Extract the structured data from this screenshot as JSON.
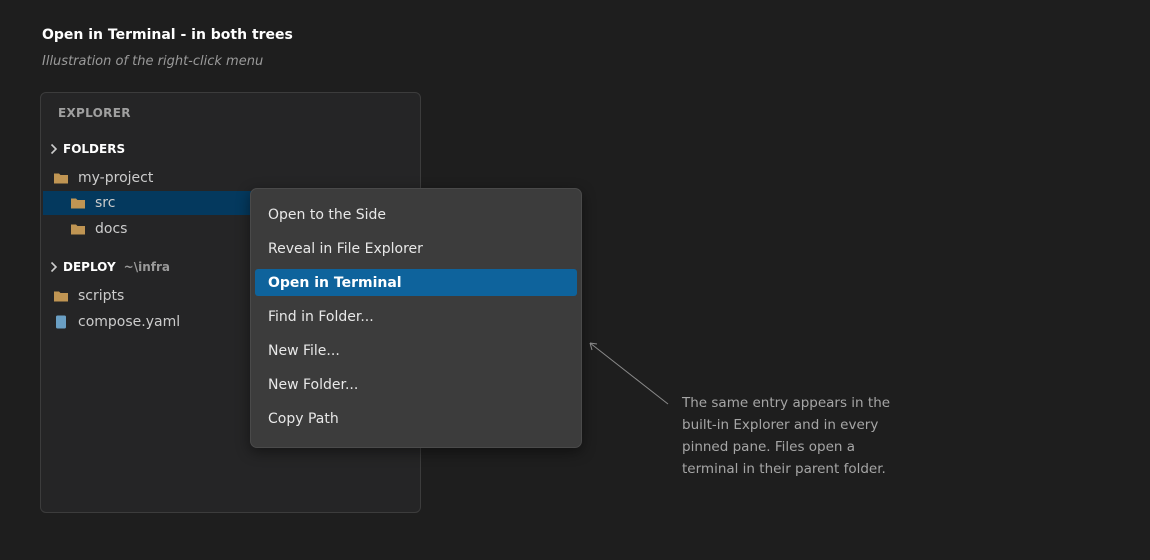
{
  "page": {
    "title": "Open in Terminal - in both trees",
    "subtitle": "Illustration of the right-click menu"
  },
  "explorer": {
    "header": "EXPLORER",
    "sections": [
      {
        "label": "FOLDERS",
        "path": ""
      },
      {
        "label": "DEPLOY",
        "path": "~\\infra"
      }
    ],
    "folders_items": [
      {
        "label": "my-project",
        "icon": "folder-icon"
      },
      {
        "label": "src",
        "icon": "folder-icon",
        "selected": true
      },
      {
        "label": "docs",
        "icon": "folder-icon"
      }
    ],
    "deploy_items": [
      {
        "label": "scripts",
        "icon": "folder-icon"
      },
      {
        "label": "compose.yaml",
        "icon": "file-icon"
      }
    ]
  },
  "context_menu": {
    "items": [
      {
        "label": "Open to the Side"
      },
      {
        "label": "Reveal in File Explorer"
      },
      {
        "label": "Open in Terminal",
        "active": true
      },
      {
        "label": "Find in Folder..."
      },
      {
        "label": "New File..."
      },
      {
        "label": "New Folder..."
      },
      {
        "label": "Copy Path"
      }
    ]
  },
  "annotation": {
    "text": "The same entry appears in the built-in Explorer and in every pinned pane. Files open a terminal in their parent folder."
  },
  "colors": {
    "background": "#1e1e1e",
    "panel": "#252526",
    "menu": "#3c3c3c",
    "selection": "#04395e",
    "menu_highlight": "#0e639c",
    "folder": "#c09553",
    "file": "#6a9fc4"
  }
}
